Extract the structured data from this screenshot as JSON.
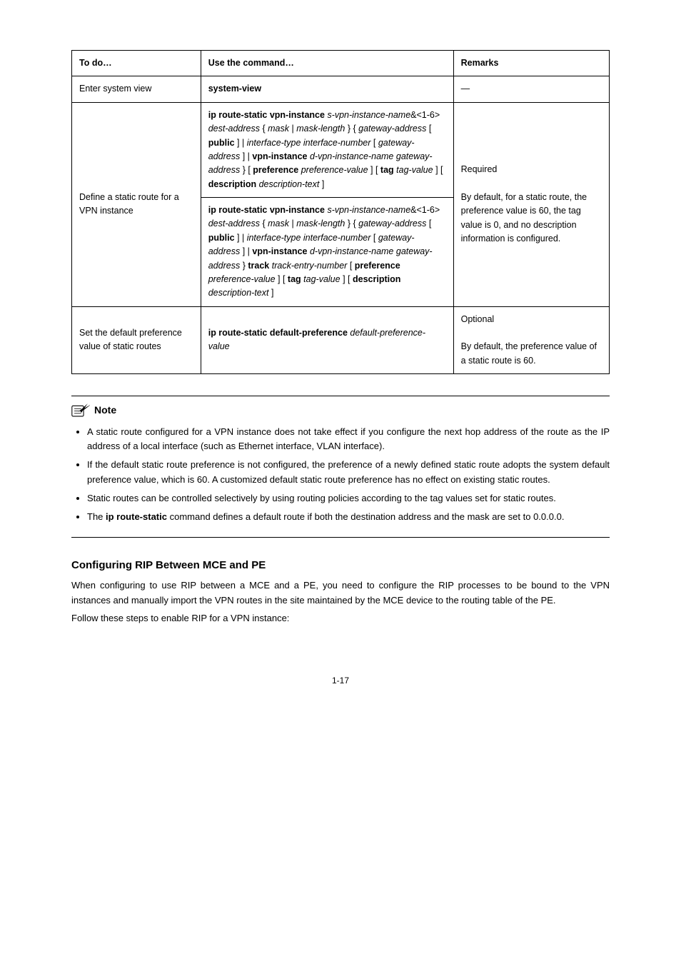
{
  "table": {
    "headers": [
      "To do…",
      "Use the command…",
      "Remarks"
    ],
    "rows": {
      "r1": {
        "todo": "Enter system view",
        "cmd_bold": "system-view",
        "rem": "—"
      },
      "r2": {
        "todo": "Define a static route for a VPN instance",
        "cmd1": {
          "b1": "ip route-static vpn-instance",
          "a1": "s-vpn-instance-name",
          "pfx": "&<1-6>",
          "a2": "dest-address",
          "mid": "{",
          "a3": "mask",
          "pipe": "|",
          "a4": "mask-length",
          "mid2": "} {",
          "a5": "gateway-address",
          "lb": "[",
          "b2": "public",
          "rb": "] |",
          "a6": "interface-type interface-number",
          "lb2": "[",
          "a7": "gateway-address",
          "rb2": "] |",
          "b3": "vpn-instance",
          "a8": "d-vpn-instance-name gateway-address",
          "rb3": "} [",
          "b4": "preference",
          "a9": "preference-value",
          "rb4": "] [",
          "b5": "tag",
          "a10": "tag-value",
          "rb5": "] [",
          "b6": "description",
          "a11": "description-text",
          "rb6": "]"
        },
        "cmd2": {
          "b1": "ip route-static vpn-instance",
          "a1": "s-vpn-instance-name",
          "pfx": "&<1-6>",
          "a2": "dest-address",
          "lb0": "{",
          "a3": "mask",
          "pipe": "|",
          "a4": "mask-length",
          "rb0": "} {",
          "a5": "gateway-address",
          "lb": "[",
          "b2": "public",
          "rb": "] |",
          "a6": "interface-type interface-number",
          "lb2": "[",
          "a7": "gateway-address",
          "rb2": "] |",
          "b3": "vpn-instance",
          "a8": "d-vpn-instance-name gateway-address",
          "rb3": "}",
          "b4": "track",
          "a9": "track-entry-number",
          "lb3": "[",
          "b5": "preference",
          "a10": "preference-value",
          "rb4": "] [",
          "b6": "tag",
          "a11": "tag-value",
          "rb5": "] [",
          "b7": "description",
          "a12": "description-text",
          "rb6": "]"
        },
        "rem_lead": "Required",
        "rem": "By default, for a static route, the preference value is 60, the tag value is 0, and no description information is configured."
      },
      "r3": {
        "todo": "Set the default preference value of static routes",
        "b1": "ip route-static default-preference",
        "a1": "default-preference-value",
        "rem_lead": "Optional",
        "rem": "By default, the preference value of a static route is 60."
      }
    }
  },
  "note": {
    "label": "Note",
    "items": [
      "A static route configured for a VPN instance does not take effect if you configure the next hop address of the route as the IP address of a local interface (such as Ethernet interface, VLAN interface).",
      "If the default static route preference is not configured, the preference of a newly defined static route adopts the system default preference value, which is 60. A customized default static route preference has no effect on existing static routes.",
      "Static routes can be controlled selectively by using routing policies according to the tag values set for static routes."
    ],
    "item4_pre": "The ",
    "item4_cmd": "ip route-static",
    "item4_post": " command defines a default route if both the destination address and the mask are set to 0.0.0.0."
  },
  "section": {
    "title": "Configuring RIP Between MCE and PE",
    "p1": "When configuring to use RIP between a MCE and a PE, you need to configure the RIP processes to be bound to the VPN instances and manually import the VPN routes in the site maintained by the MCE device to the routing table of the PE.",
    "p2": "Follow these steps to enable RIP for a VPN instance:"
  },
  "pageno": "1-17"
}
